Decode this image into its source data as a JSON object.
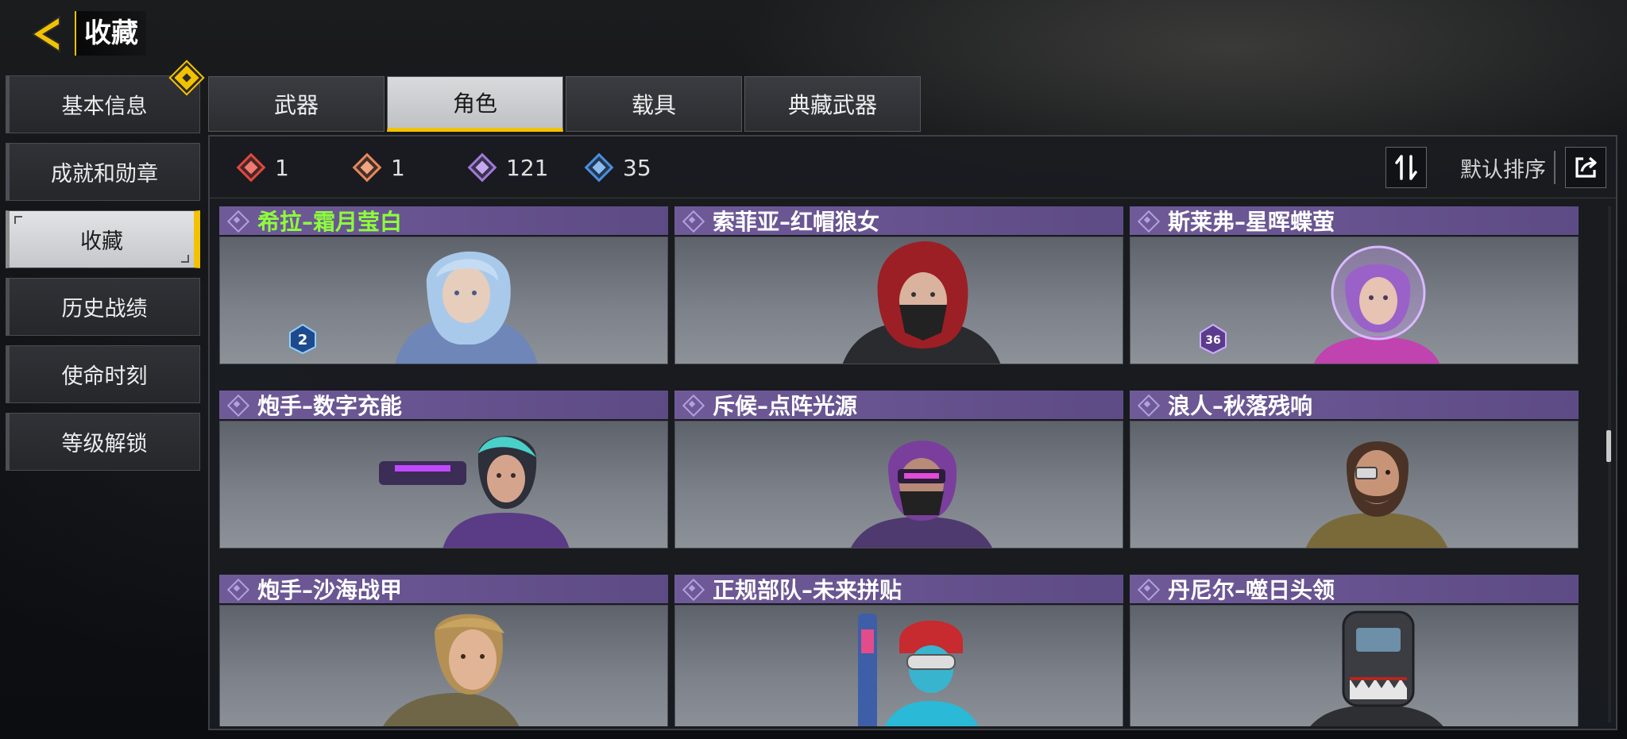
{
  "header": {
    "title": "收藏",
    "back_icon": "back-arrow-icon"
  },
  "sidebar": {
    "items": [
      {
        "label": "基本信息",
        "active": false,
        "badge": true
      },
      {
        "label": "成就和勋章",
        "active": false
      },
      {
        "label": "收藏",
        "active": true
      },
      {
        "label": "历史战绩",
        "active": false
      },
      {
        "label": "使命时刻",
        "active": false
      },
      {
        "label": "等级解锁",
        "active": false
      }
    ]
  },
  "tabs": [
    {
      "label": "武器",
      "active": false
    },
    {
      "label": "角色",
      "active": true
    },
    {
      "label": "载具",
      "active": false
    },
    {
      "label": "典藏武器",
      "active": false
    }
  ],
  "stats": [
    {
      "icon": "mythic-gem-icon",
      "value": "1",
      "color": "#e0483c"
    },
    {
      "icon": "legendary-gem-icon",
      "value": "1",
      "color": "#e8875a"
    },
    {
      "icon": "epic-gem-icon",
      "value": "121",
      "color": "#a07ad8"
    },
    {
      "icon": "rare-gem-icon",
      "value": "35",
      "color": "#4a8fe0"
    }
  ],
  "sort": {
    "label": "默认排序",
    "toggle_icon": "sort-toggle-icon",
    "share_icon": "share-icon"
  },
  "cards": [
    {
      "name": "希拉–霜月莹白",
      "new": true,
      "level_badge": "2"
    },
    {
      "name": "索菲亚–红帽狼女",
      "new": false
    },
    {
      "name": "斯莱弗–星晖蝶萤",
      "new": false,
      "level_badge": "36"
    },
    {
      "name": "炮手–数字充能",
      "new": false
    },
    {
      "name": "斥候–点阵光源",
      "new": false
    },
    {
      "name": "浪人–秋落残响",
      "new": false
    },
    {
      "name": "炮手–沙海战甲",
      "new": false
    },
    {
      "name": "正规部队–未来拼贴",
      "new": false
    },
    {
      "name": "丹尼尔–噬日头领",
      "new": false
    }
  ],
  "colors": {
    "accent": "#f2c200",
    "card_header": "#6a5693",
    "new_name": "#8dff3a"
  }
}
